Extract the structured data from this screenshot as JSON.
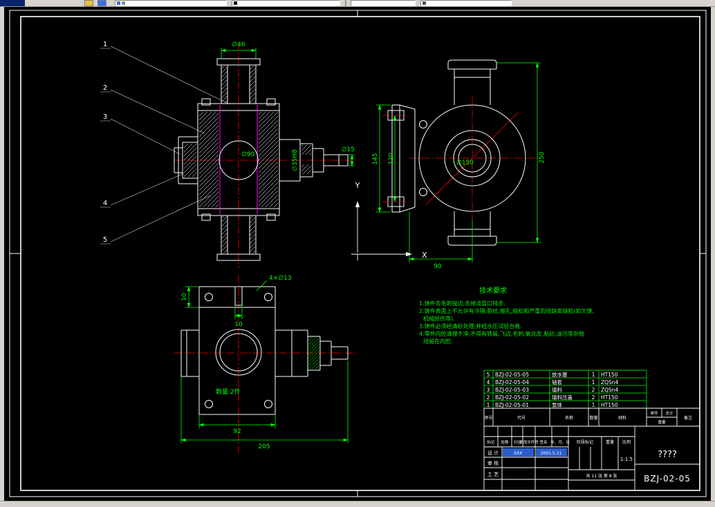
{
  "front_view": {
    "dim_d46": "∅46",
    "dim_d90": "∅90",
    "dim_d35h8": "∅35H8",
    "dim_d15": "∅15",
    "balloons": [
      "1",
      "2",
      "3",
      "4",
      "5"
    ]
  },
  "side_view": {
    "dim_145": "145",
    "dim_120": "120",
    "dim_d150": "∅150",
    "dim_250": "250",
    "dim_90": "90",
    "axis_x": "X",
    "axis_y": "Y"
  },
  "plan_view": {
    "dim_holes": "4×∅13",
    "dim_10_left": "10",
    "dim_10_slot": "10",
    "dim_92": "92",
    "dim_205": "205",
    "qty_note": "数量:2件"
  },
  "tech_req": {
    "title": "技术要求",
    "lines": [
      "1.铸件去毛刺锐边,去掉浇冒口残余.",
      "2.铸件表面上不允许有冷隔,裂纹,缩孔,缩松和严重的残缺类缺陷(如欠铸,",
      "机械损伤等).",
      "3.铸件必须经清砂处理,并经水压试验合格.",
      "4.零件内腔清理干净,不得有铁屑,飞边,毛刺,氧化皮,粘砂,油污等杂物",
      "残留在内腔."
    ]
  },
  "parts_table": {
    "rows": [
      {
        "no": "5",
        "code": "BZJ-02-05-05",
        "name": "放水塞",
        "qty": "1",
        "material": "HT150"
      },
      {
        "no": "4",
        "code": "BZJ-02-05-04",
        "name": "轴套",
        "qty": "1",
        "material": "ZQSn4"
      },
      {
        "no": "3",
        "code": "BZJ-02-05-03",
        "name": "填料",
        "qty": "2",
        "material": "ZQSn4"
      },
      {
        "no": "2",
        "code": "BZJ-02-05-02",
        "name": "填料压盖",
        "qty": "2",
        "material": "HT150"
      },
      {
        "no": "1",
        "code": "BZJ-02-05-01",
        "name": "泵体",
        "qty": "1",
        "material": "HT150"
      }
    ]
  },
  "table_header": {
    "no": "序号",
    "code": "代号",
    "name": "名称",
    "qty": "数量",
    "material": "材料",
    "unit": "单件",
    "total": "总计",
    "weight": "重量",
    "remark": "备注"
  },
  "title_block": {
    "rev": {
      "mark": "标记",
      "count": "处数",
      "zone": "分区",
      "file": "更改文件号",
      "sign": "签名",
      "date": "年、月、日"
    },
    "design": "设 计",
    "check": "审 核",
    "craft": "工 艺",
    "design_name": "XXX",
    "design_date": "2001.5.21",
    "stage": "阶段标记",
    "weight": "重量",
    "scale": "比例",
    "scale_value": "1:1.5",
    "sheets": "共 11 张 第 8 张",
    "part_name": "????",
    "drawing_no": "BZJ-02-05"
  }
}
